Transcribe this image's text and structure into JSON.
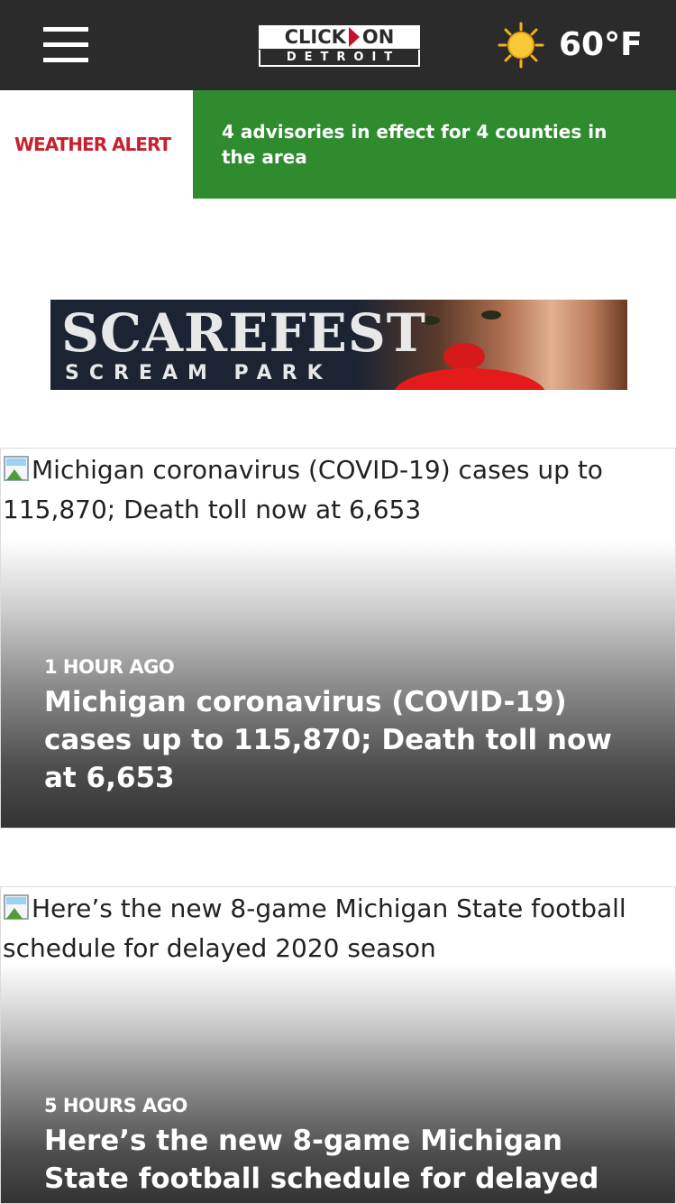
{
  "header": {
    "logo_top_left": "CLICK",
    "logo_top_right": "ON",
    "logo_bottom": "DETROIT",
    "weather_icon": "sun-icon",
    "temperature": "60°F",
    "menu_icon": "hamburger-menu-icon"
  },
  "alert": {
    "label": "WEATHER ALERT",
    "message": "4 advisories in effect for 4 counties in the area",
    "label_color": "#c8202f",
    "bg_color": "#2e8b2e"
  },
  "ad": {
    "title": "SCAREFEST",
    "subtitle": "SCREAM PARK"
  },
  "stories": [
    {
      "image_alt": "Michigan coronavirus (COVID-19) cases up to 115,870; Death toll now at 6,653",
      "time": "1 HOUR AGO",
      "headline": "Michigan coronavirus (COVID-19) cases up to 115,870; Death toll now at 6,653"
    },
    {
      "image_alt": "Here’s the new 8-game Michigan State football schedule for delayed 2020 season",
      "time": "5 HOURS AGO",
      "headline": "Here’s the new 8-game Michigan State football schedule for delayed"
    }
  ],
  "colors": {
    "header_bg": "#2b2b2b",
    "logo_accent": "#c8102e"
  }
}
